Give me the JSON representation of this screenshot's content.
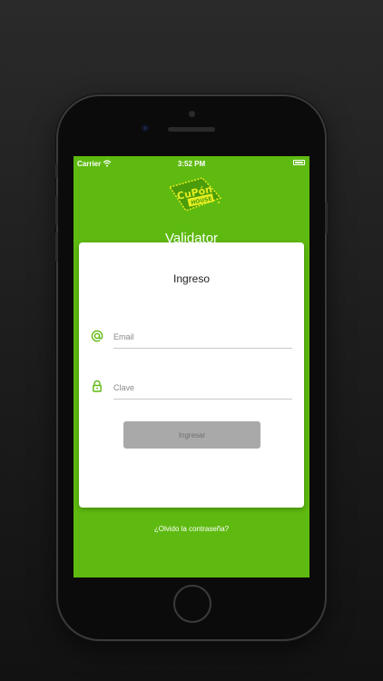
{
  "status_bar": {
    "carrier": "Carrier",
    "time": "3:52 PM"
  },
  "logo": {
    "line1": "CuPón",
    "line2": "HOUSE"
  },
  "app_title": "Validator",
  "login": {
    "title": "Ingreso",
    "email_placeholder": "Email",
    "password_placeholder": "Clave",
    "submit_label": "Ingresar",
    "forgot_label": "¿Olvido la contraseña?"
  },
  "colors": {
    "brand_green": "#5eba10",
    "logo_yellow": "#e6ee1f"
  },
  "icons": [
    "wifi-icon",
    "battery-icon",
    "at-sign-icon",
    "lock-icon"
  ]
}
